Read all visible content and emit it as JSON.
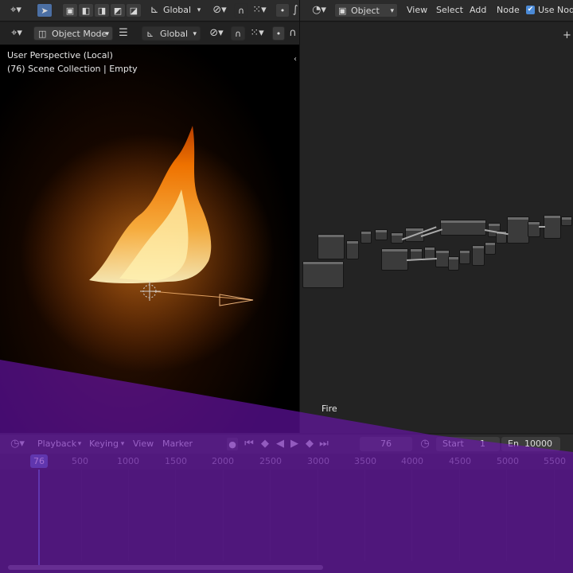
{
  "top_bar": {
    "transform_left": "Global",
    "object_selector": "Object",
    "menus": [
      "View",
      "Select",
      "Add",
      "Node"
    ],
    "use_nodes_label": "Use Nodes",
    "use_nodes_checked": true
  },
  "viewport_header": {
    "mode": "Object Mode",
    "transform": "Global"
  },
  "viewport": {
    "perspective": "User Perspective (Local)",
    "collection": "(76) Scene Collection | Empty"
  },
  "node_editor": {
    "label": "Fire"
  },
  "timeline": {
    "menus": [
      "Playback",
      "Keying",
      "View",
      "Marker"
    ],
    "current_frame": "76",
    "start_label": "Start",
    "start_value": "1",
    "end_label": "En",
    "end_value": "10000",
    "ruler_marks": [
      "500",
      "1000",
      "1500",
      "2000",
      "2500",
      "3000",
      "3500",
      "4000",
      "4500",
      "5000",
      "5500"
    ],
    "playhead_label": "76"
  },
  "icons": {
    "editor_type": "orientation-icon",
    "select_cursor": "cursor-icon",
    "snap": "magnet-icon",
    "proportional": "circle-icon",
    "play": "play-icon",
    "record": "record-icon",
    "clock": "clock-icon"
  },
  "colors": {
    "overlay_purple": "#6e14b4",
    "playhead": "#4b6fa4",
    "fire_core": "#fff2b0",
    "fire_outer": "#ff7a00"
  }
}
